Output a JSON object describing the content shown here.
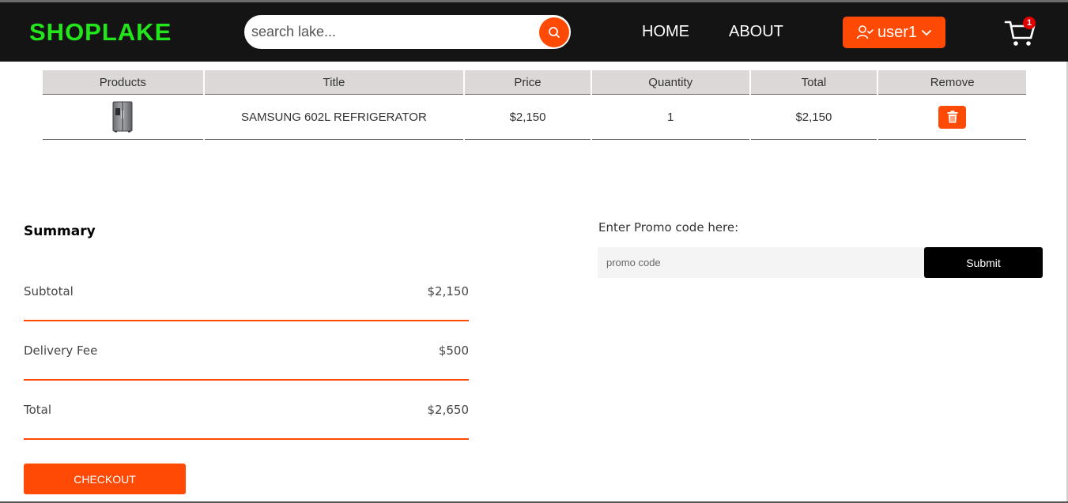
{
  "header": {
    "brand": "SHOPLAKE",
    "search_placeholder": "search lake...",
    "nav": {
      "home": "HOME",
      "about": "ABOUT"
    },
    "user": {
      "name": "user1"
    },
    "cart": {
      "count": "1"
    }
  },
  "cart_table": {
    "columns": [
      "Products",
      "Title",
      "Price",
      "Quantity",
      "Total",
      "Remove"
    ],
    "rows": [
      {
        "product_icon": "refrigerator-icon",
        "title": "SAMSUNG 602L REFRIGERATOR",
        "price": "$2,150",
        "quantity": "1",
        "total": "$2,150"
      }
    ]
  },
  "summary": {
    "title": "Summary",
    "subtotal_label": "Subtotal",
    "subtotal_value": "$2,150",
    "delivery_label": "Delivery Fee",
    "delivery_value": "$500",
    "total_label": "Total",
    "total_value": "$2,650",
    "checkout_label": "CHECKOUT"
  },
  "promo": {
    "label": "Enter Promo code here:",
    "placeholder": "promo code",
    "submit_label": "Submit"
  },
  "colors": {
    "accent": "#ff4a05",
    "brand": "#22e61b",
    "navbar": "#141414",
    "badge": "#e00000"
  }
}
